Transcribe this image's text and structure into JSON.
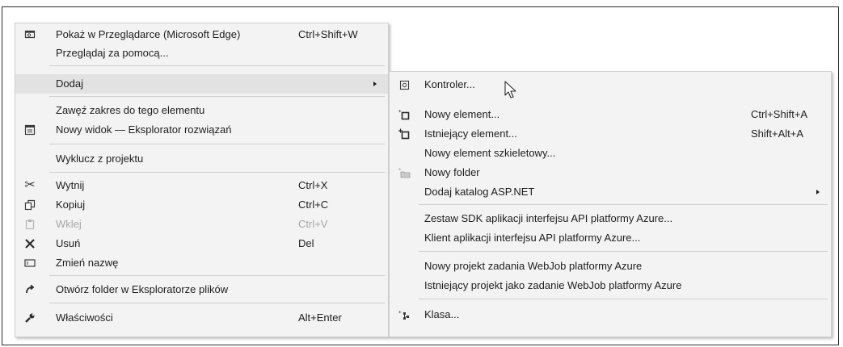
{
  "menu": {
    "items": [
      {
        "label": "Pokaż w Przeglądarce (Microsoft Edge)",
        "shortcut": "Ctrl+Shift+W",
        "icon": "browser-preview-icon"
      },
      {
        "label": "Przeglądaj za pomocą...",
        "shortcut": "",
        "icon": ""
      },
      {
        "label": "Dodaj",
        "shortcut": "",
        "icon": "",
        "submenu": true
      },
      {
        "label": "Zawęź zakres do tego elementu",
        "shortcut": "",
        "icon": ""
      },
      {
        "label": "Nowy widok — Eksplorator rozwiązań",
        "shortcut": "",
        "icon": "new-view-icon"
      },
      {
        "label": "Wyklucz z projektu",
        "shortcut": "",
        "icon": ""
      },
      {
        "label": "Wytnij",
        "shortcut": "Ctrl+X",
        "icon": "scissors-icon"
      },
      {
        "label": "Kopiuj",
        "shortcut": "Ctrl+C",
        "icon": "copy-icon"
      },
      {
        "label": "Wklej",
        "shortcut": "Ctrl+V",
        "icon": "paste-icon",
        "disabled": true
      },
      {
        "label": "Usuń",
        "shortcut": "Del",
        "icon": "delete-x-icon"
      },
      {
        "label": "Zmień nazwę",
        "shortcut": "",
        "icon": "rename-icon"
      },
      {
        "label": "Otwórz folder w Eksploratorze plików",
        "shortcut": "",
        "icon": "open-folder-arrow-icon"
      },
      {
        "label": "Właściwości",
        "shortcut": "Alt+Enter",
        "icon": "wrench-icon"
      }
    ]
  },
  "submenu": {
    "items": [
      {
        "label": "Kontroler...",
        "shortcut": "",
        "icon": "controller-icon"
      },
      {
        "label": "Nowy element...",
        "shortcut": "Ctrl+Shift+A",
        "icon": "new-item-icon"
      },
      {
        "label": "Istniejący element...",
        "shortcut": "Shift+Alt+A",
        "icon": "existing-item-icon"
      },
      {
        "label": "Nowy element szkieletowy...",
        "shortcut": "",
        "icon": ""
      },
      {
        "label": "Nowy folder",
        "shortcut": "",
        "icon": "new-folder-icon"
      },
      {
        "label": "Dodaj katalog ASP.NET",
        "shortcut": "",
        "icon": "",
        "submenu": true
      },
      {
        "label": "Zestaw SDK aplikacji interfejsu API platformy Azure...",
        "shortcut": "",
        "icon": ""
      },
      {
        "label": "Klient aplikacji interfejsu API platformy Azure...",
        "shortcut": "",
        "icon": ""
      },
      {
        "label": "Nowy projekt zadania WebJob platformy Azure",
        "shortcut": "",
        "icon": ""
      },
      {
        "label": "Istniejący projekt jako zadanie WebJob platformy Azure",
        "shortcut": "",
        "icon": ""
      },
      {
        "label": "Klasa...",
        "shortcut": "",
        "icon": "class-icon"
      }
    ]
  }
}
